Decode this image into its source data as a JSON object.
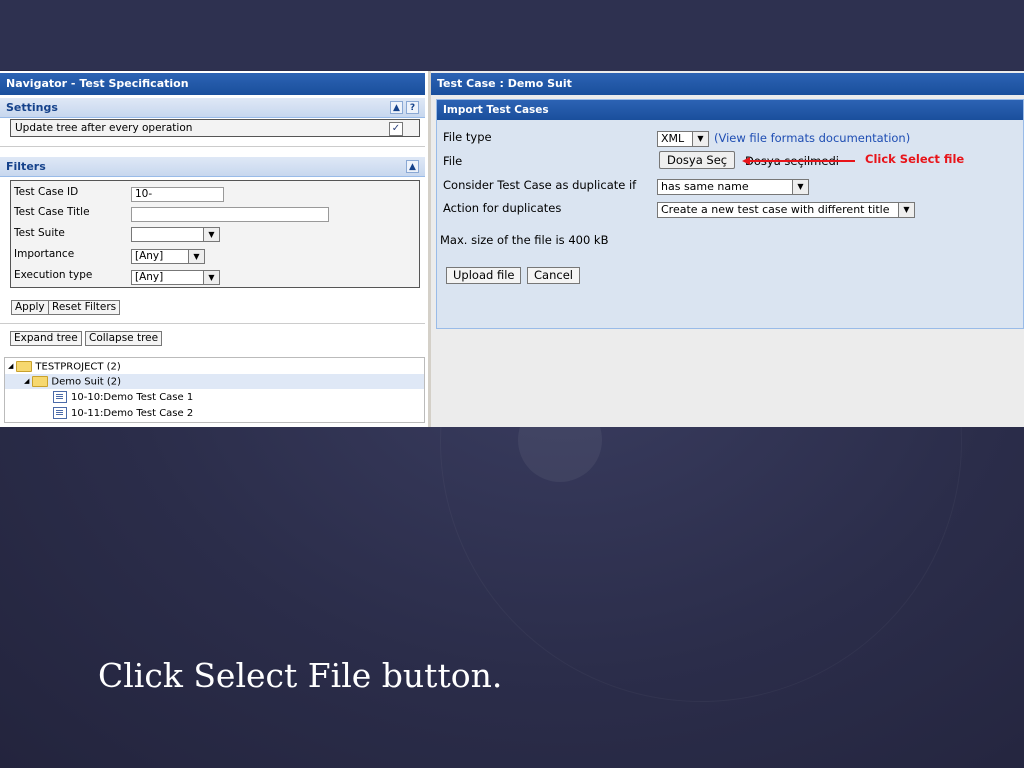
{
  "navigator": {
    "title": "Navigator - Test Specification",
    "settings": {
      "header": "Settings",
      "up_icon": "▲",
      "help_icon": "?",
      "update_tree_label": "Update tree after every operation",
      "update_tree_checked": true
    },
    "filters": {
      "header": "Filters",
      "collapse_icon": "▲",
      "fields": {
        "test_case_id_label": "Test Case ID",
        "test_case_id_value": "10-",
        "test_case_title_label": "Test Case Title",
        "test_case_title_value": "",
        "test_suite_label": "Test Suite",
        "test_suite_value": "",
        "importance_label": "Importance",
        "importance_value": "[Any]",
        "execution_type_label": "Execution type",
        "execution_type_value": "[Any]"
      },
      "apply_label": "Apply",
      "reset_label": "Reset Filters"
    },
    "tree_buttons": {
      "expand_label": "Expand tree",
      "collapse_label": "Collapse tree"
    },
    "tree": {
      "project": "TESTPROJECT (2)",
      "suite": "Demo Suit (2)",
      "cases": [
        "10-10:Demo Test Case 1",
        "10-11:Demo Test Case 2"
      ]
    }
  },
  "test_case": {
    "title": "Test Case : Demo Suit",
    "panel_title": "Import Test Cases",
    "file_type_label": "File type",
    "file_type_value": "XML",
    "formats_link": "(View file formats documentation)",
    "file_label": "File",
    "choose_button": "Dosya Seç",
    "no_file_text": "Dosya seçilmedi",
    "annotation": "Click Select file",
    "duplicate_label": "Consider Test Case as duplicate if",
    "duplicate_value": "has same name",
    "action_label": "Action for duplicates",
    "action_value": "Create a new test case with different title",
    "max_size_text": "Max. size of the file is 400 kB",
    "upload_label": "Upload file",
    "cancel_label": "Cancel"
  },
  "caption": "Click Select File button.",
  "colors": {
    "slide_bg": "#2b2d4a",
    "title_bar": "#1a4f9c",
    "annotation_red": "#e8141a",
    "link_blue": "#1e4db3"
  }
}
